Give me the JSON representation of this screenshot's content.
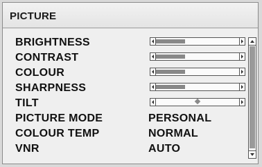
{
  "title": "PICTURE",
  "items": [
    {
      "label": "BRIGHTNESS",
      "type": "slider",
      "level": 0.35,
      "selected": true
    },
    {
      "label": "CONTRAST",
      "type": "slider",
      "level": 0.35
    },
    {
      "label": "COLOUR",
      "type": "slider",
      "level": 0.35
    },
    {
      "label": "SHARPNESS",
      "type": "slider",
      "level": 0.35
    },
    {
      "label": "TILT",
      "type": "centered-slider",
      "level": 0.5
    },
    {
      "label": "PICTURE MODE",
      "type": "value",
      "value": "PERSONAL"
    },
    {
      "label": "COLOUR TEMP",
      "type": "value",
      "value": "NORMAL"
    },
    {
      "label": "VNR",
      "type": "value",
      "value": "AUTO"
    }
  ],
  "scrollbar": {
    "position": 0,
    "visible_fraction": 0.9
  },
  "colors": {
    "background": "#efefef",
    "highlight": "#c9c9c9",
    "fill": "#888888"
  }
}
